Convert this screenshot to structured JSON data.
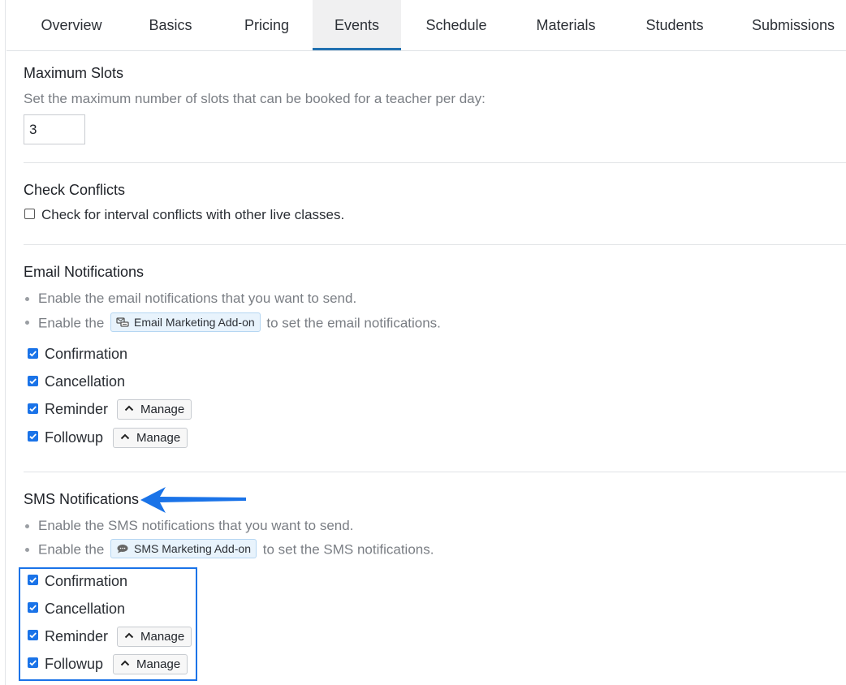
{
  "tabs": [
    {
      "label": "Overview",
      "active": false
    },
    {
      "label": "Basics",
      "active": false
    },
    {
      "label": "Pricing",
      "active": false
    },
    {
      "label": "Events",
      "active": true
    },
    {
      "label": "Schedule",
      "active": false
    },
    {
      "label": "Materials",
      "active": false
    },
    {
      "label": "Students",
      "active": false
    },
    {
      "label": "Submissions",
      "active": false
    }
  ],
  "max_slots": {
    "title": "Maximum Slots",
    "description": "Set the maximum number of slots that can be booked for a teacher per day:",
    "value": "3"
  },
  "check_conflicts": {
    "title": "Check Conflicts",
    "label": "Check for interval conflicts with other live classes.",
    "checked": false
  },
  "email_notifications": {
    "title": "Email Notifications",
    "bullet1": "Enable the email notifications that you want to send.",
    "bullet2_prefix": "Enable the",
    "addon_label": "Email Marketing Add-on",
    "bullet2_suffix": "to set the email notifications.",
    "items": [
      {
        "label": "Confirmation",
        "checked": true
      },
      {
        "label": "Cancellation",
        "checked": true
      },
      {
        "label": "Reminder",
        "checked": true,
        "manage": "Manage"
      },
      {
        "label": "Followup",
        "checked": true,
        "manage": "Manage"
      }
    ]
  },
  "sms_notifications": {
    "title": "SMS Notifications",
    "bullet1": "Enable the SMS notifications that you want to send.",
    "bullet2_prefix": "Enable the",
    "addon_label": "SMS Marketing Add-on",
    "bullet2_suffix": "to set the SMS notifications.",
    "items": [
      {
        "label": "Confirmation",
        "checked": true
      },
      {
        "label": "Cancellation",
        "checked": true
      },
      {
        "label": "Reminder",
        "checked": true,
        "manage": "Manage"
      },
      {
        "label": "Followup",
        "checked": true,
        "manage": "Manage"
      }
    ]
  },
  "colors": {
    "accent": "#1a73e8",
    "active_tab_underline": "#2271b1",
    "addon_badge_bg": "#e8f3fc"
  },
  "icons": {
    "email_addon": "email-marketing-icon",
    "sms_addon": "sms-chat-icon",
    "manage": "chevron-up-icon",
    "annotation": "arrow-left-icon"
  }
}
